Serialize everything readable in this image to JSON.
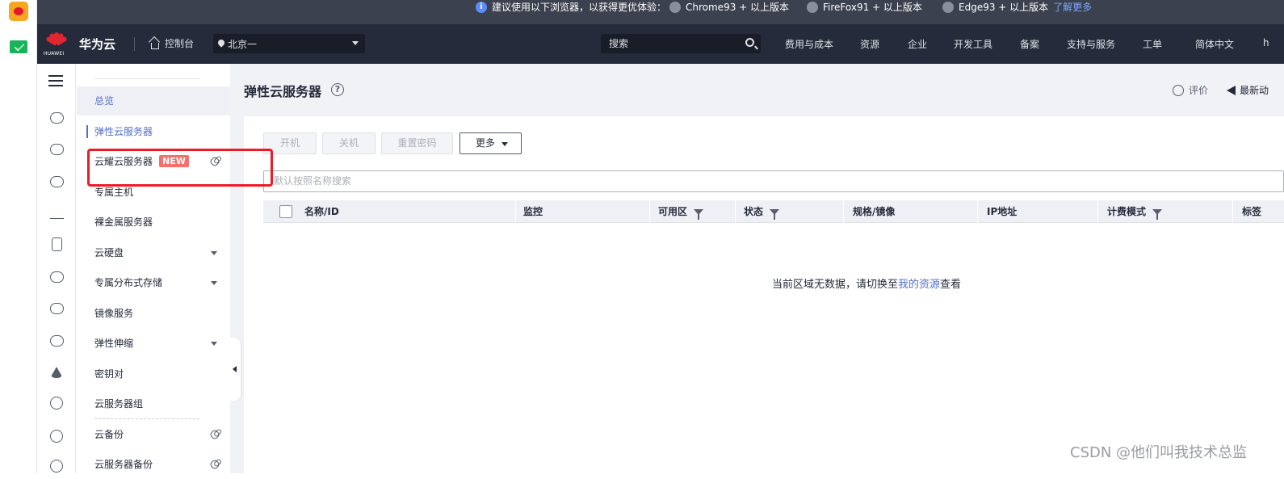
{
  "banner": {
    "notice": "建议使用以下浏览器，以获得更优体验：",
    "browsers": [
      "Chrome93 + 以上版本",
      "FireFox91 + 以上版本",
      "Edge93 + 以上版本"
    ],
    "learn_more": "了解更多"
  },
  "topnav": {
    "logo_text": "HUAWEI",
    "brand": "华为云",
    "console": "控制台",
    "region": "北京一",
    "search_placeholder": "搜索",
    "items": [
      "费用与成本",
      "资源",
      "企业",
      "开发工具",
      "备案",
      "支持与服务",
      "工单",
      "简体中文",
      "h"
    ]
  },
  "sidebar": {
    "items": [
      {
        "label": "总览"
      },
      {
        "label": "弹性云服务器"
      },
      {
        "label": "云耀云服务器",
        "badge": "NEW"
      },
      {
        "label": "专属主机"
      },
      {
        "label": "裸金属服务器"
      },
      {
        "label": "云硬盘"
      },
      {
        "label": "专属分布式存储"
      },
      {
        "label": "镜像服务"
      },
      {
        "label": "弹性伸缩"
      },
      {
        "label": "密钥对"
      },
      {
        "label": "云服务器组"
      },
      {
        "label": "云备份"
      },
      {
        "label": "云服务器备份"
      }
    ]
  },
  "page": {
    "title": "弹性云服务器",
    "rate": "评价",
    "latest": "最新动"
  },
  "toolbar": {
    "start": "开机",
    "stop": "关机",
    "reset_password": "重置密码",
    "more": "更多"
  },
  "filter": {
    "placeholder": "默认按照名称搜索"
  },
  "table": {
    "columns": [
      "名称/ID",
      "监控",
      "可用区",
      "状态",
      "规格/镜像",
      "IP地址",
      "计费模式",
      "标签"
    ],
    "empty_prefix": "当前区域无数据，请切换至",
    "empty_link": "我的资源",
    "empty_suffix": "查看"
  },
  "watermark": "CSDN @他们叫我技术总监",
  "colors": {
    "topnav_bg": "#252b3a",
    "accent": "#526ecc",
    "badge": "#f66f6a",
    "highlight": "#ec1c24"
  }
}
